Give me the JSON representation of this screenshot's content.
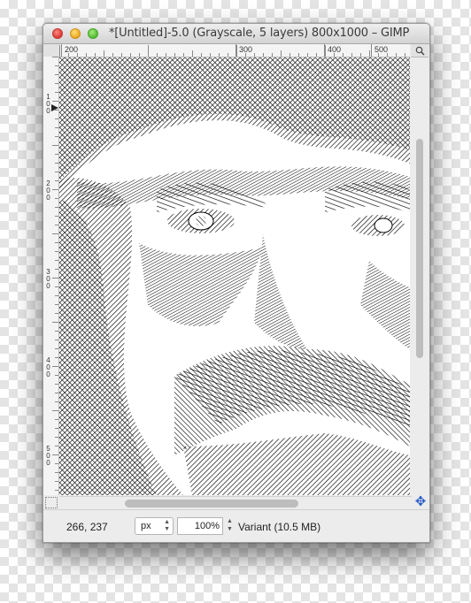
{
  "window": {
    "title": "*[Untitled]-5.0 (Grayscale, 5 layers) 800x1000 – GIMP"
  },
  "ruler_h": {
    "labels": [
      "200",
      "300",
      "400",
      "500"
    ]
  },
  "ruler_v": {
    "labels": [
      "100",
      "200",
      "300",
      "400",
      "500"
    ]
  },
  "statusbar": {
    "coords": "266, 237",
    "unit": "px",
    "zoom": "100%",
    "message": "Variant (10.5 MB)"
  },
  "icons": {
    "navigate": "navigate-icon",
    "quick_mask": "quick-mask-icon",
    "zoom_nav": "zoom-navigation-icon"
  }
}
